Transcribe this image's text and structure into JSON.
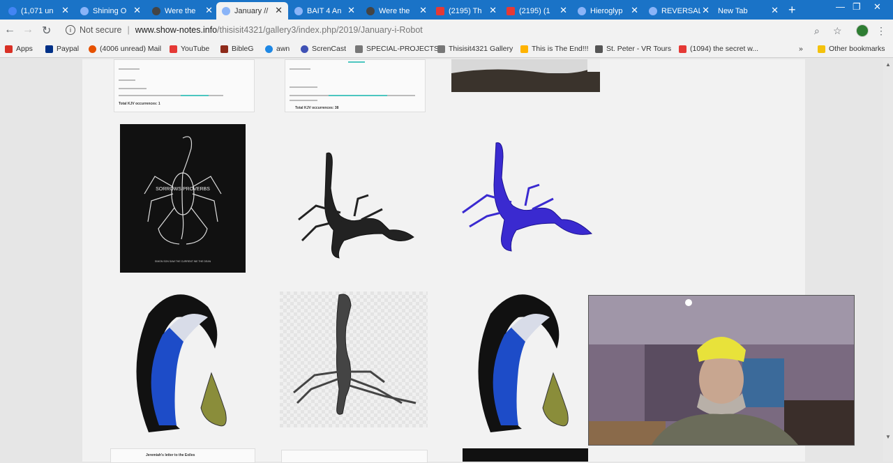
{
  "tabs": [
    {
      "title": "(1,071 un",
      "color": "#4285f4",
      "active": false
    },
    {
      "title": "Shining O",
      "color": "#8ab4f8",
      "active": false
    },
    {
      "title": "Were the",
      "color": "#444444",
      "active": false
    },
    {
      "title": "January //",
      "color": "#8ab4f8",
      "active": true
    },
    {
      "title": "BAIT 4 An",
      "color": "#8ab4f8",
      "active": false
    },
    {
      "title": "Were the",
      "color": "#444444",
      "active": false
    },
    {
      "title": "(2195) Th",
      "color": "#e53935",
      "active": false
    },
    {
      "title": "(2195) (1",
      "color": "#e53935",
      "active": false
    },
    {
      "title": "Hieroglyp",
      "color": "#8ab4f8",
      "active": false
    },
    {
      "title": "REVERSAL",
      "color": "#8ab4f8",
      "active": false
    },
    {
      "title": "New Tab",
      "color": "#1a73c7",
      "active": false
    }
  ],
  "address": {
    "security": "Not secure",
    "host": "www.show-notes.info",
    "path": "/thisisit4321/gallery3/index.php/2019/January-i-Robot"
  },
  "bookmarks": [
    {
      "label": "Apps",
      "color": "#d93025"
    },
    {
      "label": "Paypal",
      "color": "#003087"
    },
    {
      "label": "(4006 unread) Mail",
      "color": "#e65100"
    },
    {
      "label": "YouTube",
      "color": "#e53935"
    },
    {
      "label": "BibleG",
      "color": "#8e2a1a"
    },
    {
      "label": "awn",
      "color": "#1e88e5"
    },
    {
      "label": "ScrenCast",
      "color": "#3f51b5"
    },
    {
      "label": "SPECIAL-PROJECTS",
      "color": "#777777"
    },
    {
      "label": "Thisisit4321 Gallery",
      "color": "#777777"
    },
    {
      "label": "This is The End!!!",
      "color": "#ffb300"
    },
    {
      "label": "St. Peter - VR Tours",
      "color": "#555555"
    },
    {
      "label": "(1094) the secret w...",
      "color": "#e53935"
    },
    {
      "label": "Other bookmarks",
      "color": "#f4c20d"
    }
  ],
  "gallery": {
    "scorpion_cover_text": "SORROWS PROVERBS",
    "scorpion_cover_caption": "SIMON SON SAW THE CURRENT INE THE DEAN",
    "doc_caption_left": "Total KJV occurrences: 1",
    "doc_caption_right": "Total KJV occurrences: 38",
    "doc_bottom_left": "Jeremiah's letter to the Exiles"
  },
  "colors": {
    "accent": "#1a73c7",
    "scorpion_blue": "#2a2ad0"
  }
}
